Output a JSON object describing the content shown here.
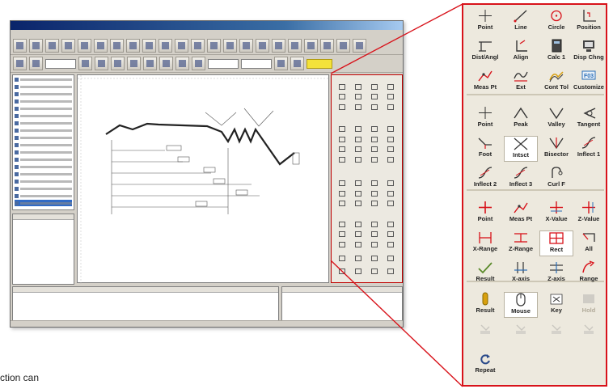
{
  "caption": "ction can",
  "colors": {
    "accent": "#d8121a",
    "icon_red": "#d8121a",
    "icon_blue": "#2a6eb8"
  },
  "tool_sections": [
    {
      "tools": [
        {
          "label": "Point",
          "icon": "crosshair-icon"
        },
        {
          "label": "Line",
          "icon": "line-icon"
        },
        {
          "label": "Circle",
          "icon": "circle-icon"
        },
        {
          "label": "Position",
          "icon": "position-icon"
        },
        {
          "label": "Dist/Angl",
          "icon": "distance-angle-icon"
        },
        {
          "label": "Align",
          "icon": "align-icon"
        },
        {
          "label": "Calc 1",
          "icon": "calculator-icon"
        },
        {
          "label": "Disp Chng",
          "icon": "display-change-icon"
        },
        {
          "label": "Meas Pt",
          "icon": "measure-point-icon"
        },
        {
          "label": "Ext",
          "icon": "external-icon"
        },
        {
          "label": "Cont Tol",
          "icon": "contour-tolerance-icon"
        },
        {
          "label": "Customize",
          "icon": "customize-icon"
        }
      ]
    },
    {
      "tools": [
        {
          "label": "Point",
          "icon": "crosshair-icon"
        },
        {
          "label": "Peak",
          "icon": "peak-icon"
        },
        {
          "label": "Valley",
          "icon": "valley-icon"
        },
        {
          "label": "Tangent",
          "icon": "tangent-icon"
        },
        {
          "label": "Foot",
          "icon": "foot-icon"
        },
        {
          "label": "Intsct",
          "icon": "intersect-icon",
          "pressed": true
        },
        {
          "label": "Bisector",
          "icon": "bisector-icon"
        },
        {
          "label": "Inflect 1",
          "icon": "inflect-icon"
        },
        {
          "label": "Inflect 2",
          "icon": "inflect-icon"
        },
        {
          "label": "Inflect 3",
          "icon": "inflect-icon"
        },
        {
          "label": "Curl F",
          "icon": "curl-icon"
        }
      ]
    },
    {
      "tools": [
        {
          "label": "Point",
          "icon": "red-crosshair-icon"
        },
        {
          "label": "Meas Pt",
          "icon": "measure-point-icon"
        },
        {
          "label": "X-Value",
          "icon": "x-value-icon"
        },
        {
          "label": "Z-Value",
          "icon": "z-value-icon"
        },
        {
          "label": "X-Range",
          "icon": "x-range-icon"
        },
        {
          "label": "Z-Range",
          "icon": "z-range-icon"
        },
        {
          "label": "Rect",
          "icon": "rectangle-icon",
          "pressed": true
        },
        {
          "label": "All",
          "icon": "all-icon"
        },
        {
          "label": "Result",
          "icon": "result-check-icon"
        },
        {
          "label": "X-axis",
          "icon": "x-axis-icon"
        },
        {
          "label": "Z-axis",
          "icon": "z-axis-icon"
        },
        {
          "label": "Range",
          "icon": "range-icon"
        }
      ]
    },
    {
      "tools": [
        {
          "label": "Result",
          "icon": "result-icon"
        },
        {
          "label": "Mouse",
          "icon": "mouse-icon",
          "pressed": true
        },
        {
          "label": "Key",
          "icon": "key-icon"
        },
        {
          "label": "Hold",
          "icon": "hold-icon",
          "disabled": true
        },
        {
          "label": "",
          "icon": "disabled-icon",
          "disabled": true
        },
        {
          "label": "",
          "icon": "disabled-icon",
          "disabled": true
        },
        {
          "label": "",
          "icon": "disabled-icon",
          "disabled": true
        },
        {
          "label": "",
          "icon": "disabled-icon",
          "disabled": true
        },
        {
          "label": "Repeat",
          "icon": "repeat-icon"
        }
      ]
    }
  ]
}
